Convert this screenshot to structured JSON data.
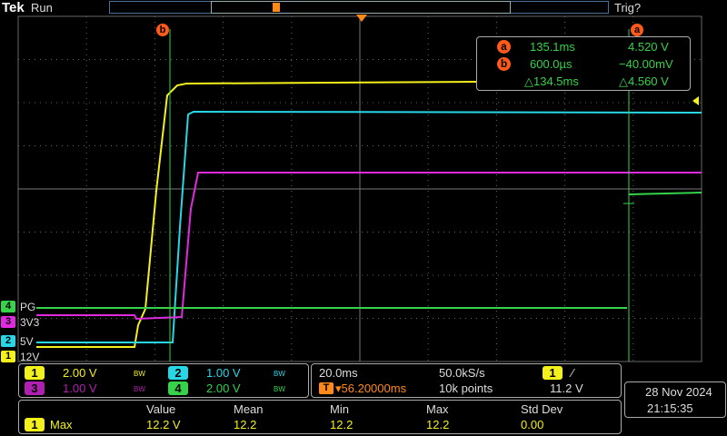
{
  "header": {
    "brand": "Tek",
    "acq_state": "Run",
    "trigger_status": "Trig?"
  },
  "colors": {
    "ch1": "#f4f01a",
    "ch2": "#27d7e6",
    "ch3": "#e02ae0",
    "ch4": "#35d24a",
    "cursor": "#ff5a1a",
    "grid": "#555555"
  },
  "cursors": {
    "a_label": "a",
    "b_label": "b",
    "a_time": "135.1ms",
    "a_volt": "4.520 V",
    "b_time": "600.0µs",
    "b_volt": "−40.00mV",
    "delta_time": "△134.5ms",
    "delta_volt": "△4.560 V"
  },
  "waveform_labels": [
    {
      "num": "4",
      "name": "PG"
    },
    {
      "num": "3",
      "name": "3V3"
    },
    {
      "num": "2",
      "name": "5V"
    },
    {
      "num": "1",
      "name": "12V"
    }
  ],
  "channels": [
    {
      "num": "1",
      "scale": "2.00 V",
      "bw": "BW"
    },
    {
      "num": "2",
      "scale": "1.00 V",
      "bw": "BW"
    },
    {
      "num": "3",
      "scale": "1.00 V",
      "bw": "BW"
    },
    {
      "num": "4",
      "scale": "2.00 V",
      "bw": "BW"
    }
  ],
  "timebase": {
    "time_div": "20.0ms",
    "sample_rate": "50.0kS/s",
    "trigger_pos": "▾56.20000ms",
    "record_length": "10k points",
    "trigger_source": "1",
    "trigger_slope": "⁄",
    "trigger_level": "11.2 V"
  },
  "datetime": {
    "date": "28 Nov 2024",
    "time": "21:15:35"
  },
  "measurements": {
    "headers": [
      "Value",
      "Mean",
      "Min",
      "Max",
      "Std Dev"
    ],
    "rows": [
      {
        "source": "1",
        "type": "Max",
        "value": "12.2 V",
        "mean": "12.2",
        "min": "12.2",
        "max": "12.2",
        "std": "0.00"
      }
    ]
  }
}
